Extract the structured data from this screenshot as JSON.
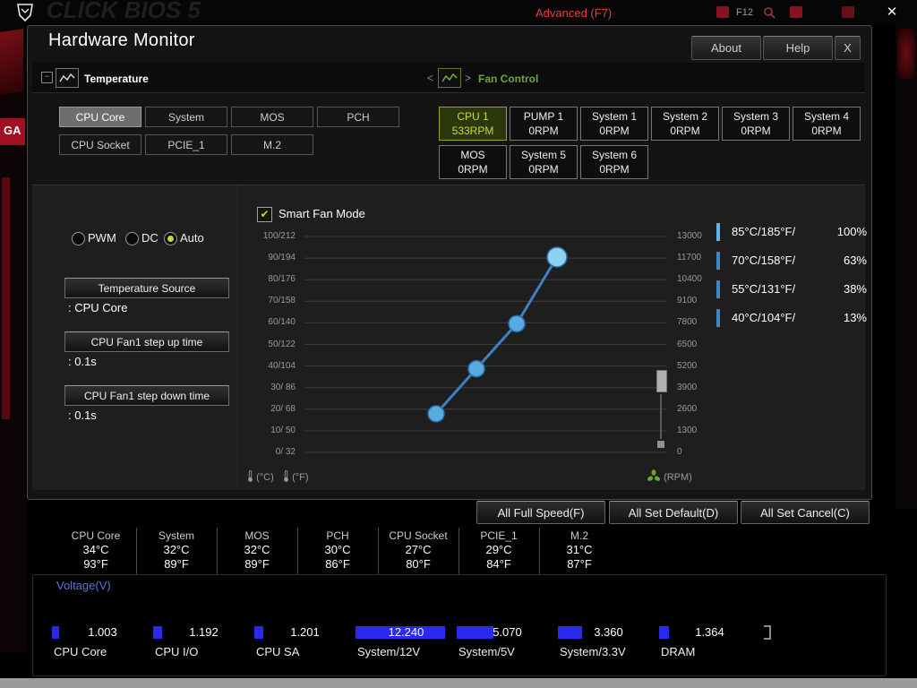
{
  "chrome": {
    "bios_text": "CLICK BIOS 5",
    "mode": "Advanced (F7)",
    "f12": "F12",
    "side_label": "GA",
    "close": "✕"
  },
  "window": {
    "title": "Hardware Monitor",
    "about": "About",
    "help": "Help",
    "close": "X"
  },
  "sections": {
    "temperature": "Temperature",
    "fan_control": "Fan Control",
    "prev_arrow": "<",
    "next_arrow": ">"
  },
  "temp_buttons": [
    {
      "label": "CPU Core"
    },
    {
      "label": "System"
    },
    {
      "label": "MOS"
    },
    {
      "label": "PCH"
    },
    {
      "label": "CPU Socket"
    },
    {
      "label": "PCIE_1"
    },
    {
      "label": "M.2"
    }
  ],
  "fan_buttons": [
    {
      "name": "CPU 1",
      "rpm": "533RPM"
    },
    {
      "name": "PUMP 1",
      "rpm": "0RPM"
    },
    {
      "name": "System 1",
      "rpm": "0RPM"
    },
    {
      "name": "System 2",
      "rpm": "0RPM"
    },
    {
      "name": "System 3",
      "rpm": "0RPM"
    },
    {
      "name": "System 4",
      "rpm": "0RPM"
    },
    {
      "name": "MOS",
      "rpm": "0RPM"
    },
    {
      "name": "System 5",
      "rpm": "0RPM"
    },
    {
      "name": "System 6",
      "rpm": "0RPM"
    }
  ],
  "settings": {
    "mode_pwm": "PWM",
    "mode_dc": "DC",
    "mode_auto": "Auto",
    "selected_mode": "Auto",
    "temp_source_label": "Temperature Source",
    "temp_source_value": ": CPU Core",
    "step_up_label": "CPU Fan1 step up time",
    "step_up_value": ": 0.1s",
    "step_down_label": "CPU Fan1 step down time",
    "step_down_value": ": 0.1s",
    "smart_fan_label": "Smart Fan Mode"
  },
  "chart_data": {
    "type": "line",
    "title": "Smart Fan Mode",
    "left_axis_ticks": [
      "100/212",
      "90/194",
      "80/176",
      "70/158",
      "60/140",
      "50/122",
      "40/104",
      "30/ 86",
      "20/ 68",
      "10/ 50",
      "0/ 32"
    ],
    "right_axis_ticks": [
      "13000",
      "11700",
      "10400",
      "9100",
      "7800",
      "6500",
      "5200",
      "3900",
      "2600",
      "1300",
      "0"
    ],
    "x_unit_c": "(°C)",
    "x_unit_f": "(°F)",
    "rpm_unit": "(RPM)",
    "points": [
      {
        "temp_c": 40,
        "temp_f": 104,
        "percent": 13
      },
      {
        "temp_c": 55,
        "temp_f": 131,
        "percent": 38
      },
      {
        "temp_c": 70,
        "temp_f": 158,
        "percent": 63
      },
      {
        "temp_c": 85,
        "temp_f": 185,
        "percent": 100
      }
    ],
    "line_color": "#3f7fc4",
    "point_color": "#57acdf",
    "top_point_color": "#8fd2f0"
  },
  "fan_point_rows": [
    {
      "label": "85°C/185°F/",
      "value": "100%"
    },
    {
      "label": "70°C/158°F/",
      "value": "63%"
    },
    {
      "label": "55°C/131°F/",
      "value": "38%"
    },
    {
      "label": "40°C/104°F/",
      "value": "13%"
    }
  ],
  "footer_buttons": {
    "full_speed": "All Full Speed(F)",
    "set_default": "All Set Default(D)",
    "set_cancel": "All Set Cancel(C)"
  },
  "temps": [
    {
      "name": "CPU Core",
      "c": "34°C",
      "f": "93°F"
    },
    {
      "name": "System",
      "c": "32°C",
      "f": "89°F"
    },
    {
      "name": "MOS",
      "c": "32°C",
      "f": "89°F"
    },
    {
      "name": "PCH",
      "c": "30°C",
      "f": "86°F"
    },
    {
      "name": "CPU Socket",
      "c": "27°C",
      "f": "80°F"
    },
    {
      "name": "PCIE_1",
      "c": "29°C",
      "f": "84°F"
    },
    {
      "name": "M.2",
      "c": "31°C",
      "f": "87°F"
    }
  ],
  "voltage": {
    "title": "Voltage(V)",
    "items": [
      {
        "name": "CPU Core",
        "value": "1.003"
      },
      {
        "name": "CPU I/O",
        "value": "1.192"
      },
      {
        "name": "CPU SA",
        "value": "1.201"
      },
      {
        "name": "System/12V",
        "value": "12.240"
      },
      {
        "name": "System/5V",
        "value": "5.070"
      },
      {
        "name": "System/3.3V",
        "value": "3.360"
      },
      {
        "name": "DRAM",
        "value": "1.364"
      }
    ]
  }
}
